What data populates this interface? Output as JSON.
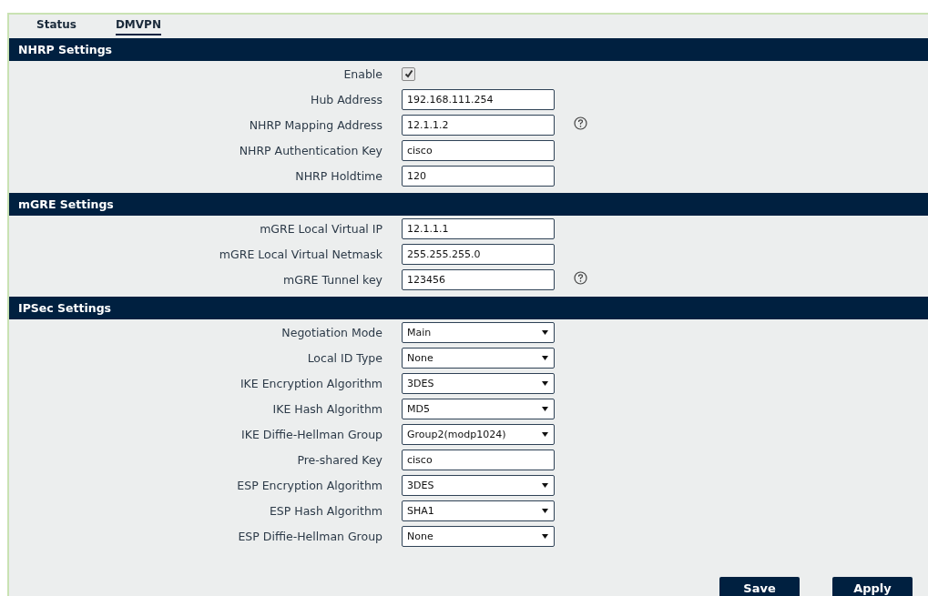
{
  "tabs": [
    {
      "label": "Status",
      "selected": false
    },
    {
      "label": "DMVPN",
      "selected": true
    }
  ],
  "sections": [
    {
      "title": "NHRP Settings",
      "rows": [
        {
          "label": "Enable",
          "kind": "checkbox",
          "checked": true
        },
        {
          "label": "Hub Address",
          "kind": "text",
          "value": "192.168.111.254"
        },
        {
          "label": "NHRP Mapping Address",
          "kind": "text",
          "value": "12.1.1.2",
          "help": true
        },
        {
          "label": "NHRP Authentication Key",
          "kind": "text",
          "value": "cisco"
        },
        {
          "label": "NHRP Holdtime",
          "kind": "text",
          "value": "120"
        }
      ]
    },
    {
      "title": "mGRE Settings",
      "rows": [
        {
          "label": "mGRE Local Virtual IP",
          "kind": "text",
          "value": "12.1.1.1"
        },
        {
          "label": "mGRE Local Virtual Netmask",
          "kind": "text",
          "value": "255.255.255.0"
        },
        {
          "label": "mGRE Tunnel key",
          "kind": "text",
          "value": "123456",
          "help": true
        }
      ]
    },
    {
      "title": "IPSec Settings",
      "rows": [
        {
          "label": "Negotiation Mode",
          "kind": "select",
          "value": "Main"
        },
        {
          "label": "Local ID Type",
          "kind": "select",
          "value": "None"
        },
        {
          "label": "IKE Encryption Algorithm",
          "kind": "select",
          "value": "3DES"
        },
        {
          "label": "IKE Hash Algorithm",
          "kind": "select",
          "value": "MD5"
        },
        {
          "label": "IKE Diffie-Hellman Group",
          "kind": "select",
          "value": "Group2(modp1024)"
        },
        {
          "label": "Pre-shared Key",
          "kind": "text",
          "value": "cisco"
        },
        {
          "label": "ESP Encryption Algorithm",
          "kind": "select",
          "value": "3DES"
        },
        {
          "label": "ESP Hash Algorithm",
          "kind": "select",
          "value": "SHA1"
        },
        {
          "label": "ESP Diffie-Hellman Group",
          "kind": "select",
          "value": "None"
        }
      ]
    }
  ],
  "buttons": [
    "Save",
    "Apply"
  ]
}
